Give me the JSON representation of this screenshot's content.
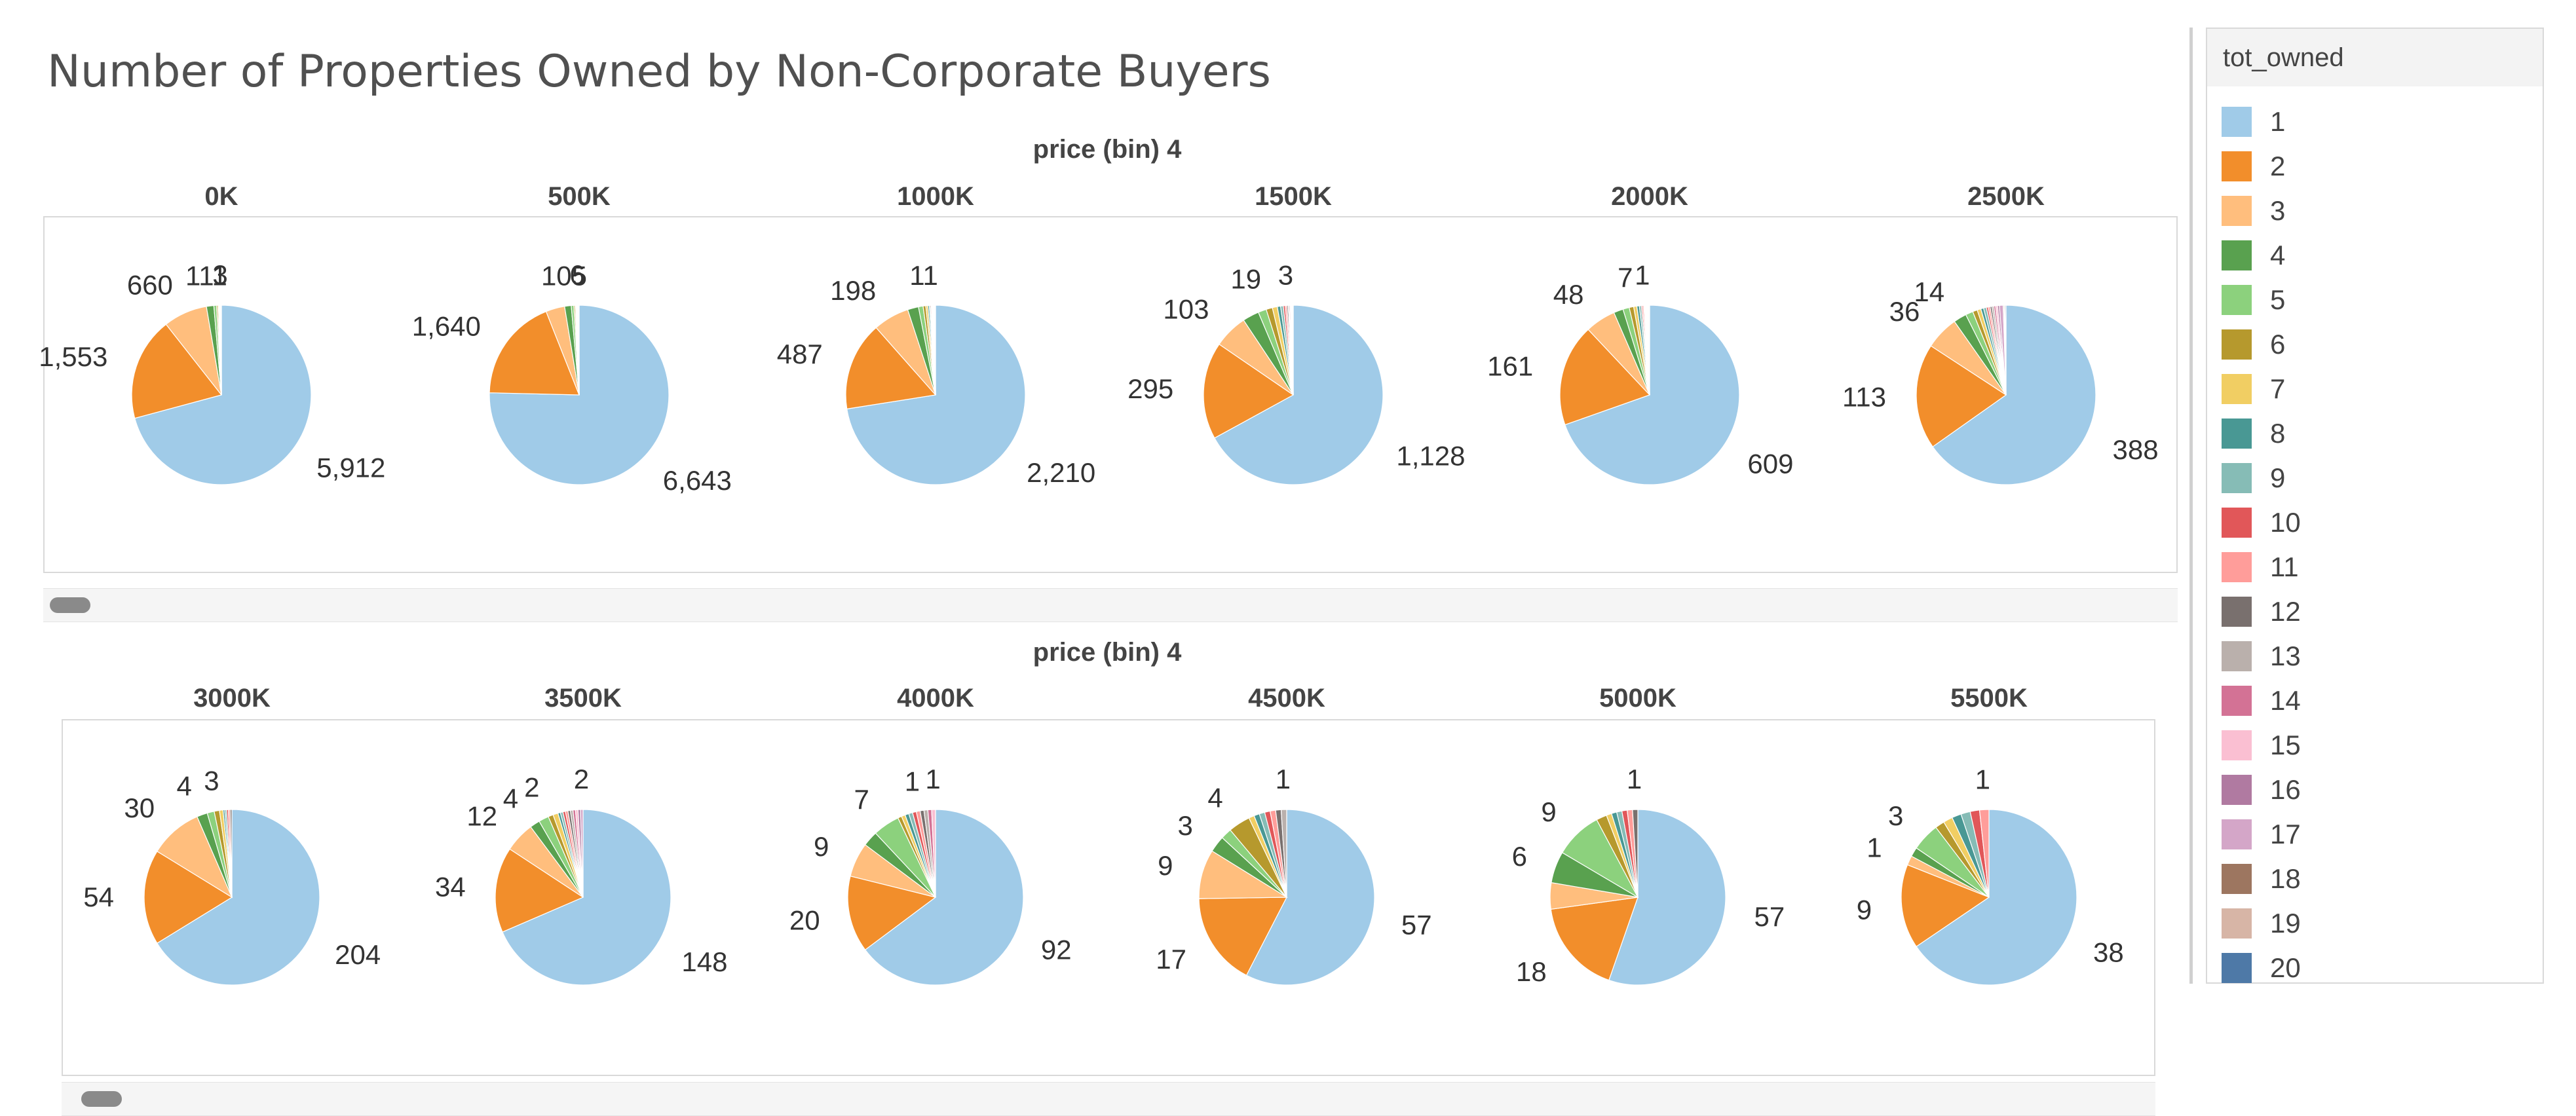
{
  "title": "Number of Properties Owned by Non-Corporate Buyers",
  "legend": {
    "title": "tot_owned",
    "items": [
      {
        "label": "1",
        "color": "#a0cbe8"
      },
      {
        "label": "2",
        "color": "#f28e2b"
      },
      {
        "label": "3",
        "color": "#ffbe7d"
      },
      {
        "label": "4",
        "color": "#59a14f"
      },
      {
        "label": "5",
        "color": "#8cd17d"
      },
      {
        "label": "6",
        "color": "#b6992d"
      },
      {
        "label": "7",
        "color": "#f1ce63"
      },
      {
        "label": "8",
        "color": "#499894"
      },
      {
        "label": "9",
        "color": "#86bcb6"
      },
      {
        "label": "10",
        "color": "#e15759"
      },
      {
        "label": "11",
        "color": "#ff9d9a"
      },
      {
        "label": "12",
        "color": "#79706e"
      },
      {
        "label": "13",
        "color": "#bab0ac"
      },
      {
        "label": "14",
        "color": "#d37295"
      },
      {
        "label": "15",
        "color": "#fabfd2"
      },
      {
        "label": "16",
        "color": "#b07aa1"
      },
      {
        "label": "17",
        "color": "#d4a6c8"
      },
      {
        "label": "18",
        "color": "#9d7660"
      },
      {
        "label": "19",
        "color": "#d7b5a6"
      },
      {
        "label": "20",
        "color": "#4e79a7"
      }
    ]
  },
  "chart_data": {
    "type": "pie",
    "facet_header": "price (bin) 4",
    "series_field": "tot_owned",
    "rows": [
      {
        "header": "price (bin) 4",
        "pies": [
          {
            "category": "0K",
            "values": [
              5912,
              1553,
              660,
              111,
              40,
              20,
              15,
              8,
              6,
              5,
              4,
              3,
              3,
              2,
              2,
              1,
              1,
              1,
              1,
              1
            ],
            "labels": [
              {
                "slice": 0,
                "text": "5,912"
              },
              {
                "slice": 1,
                "text": "1,553"
              },
              {
                "slice": 2,
                "text": "660"
              },
              {
                "slice": 3,
                "text": "111"
              },
              {
                "slice": 11,
                "text": "3"
              }
            ]
          },
          {
            "category": "500K",
            "values": [
              6643,
              1640,
              300,
              105,
              40,
              20,
              15,
              10,
              8,
              6,
              6,
              4,
              3,
              3,
              2,
              2,
              2,
              1,
              1,
              1
            ],
            "labels": [
              {
                "slice": 0,
                "text": "6,643"
              },
              {
                "slice": 1,
                "text": "1,640"
              },
              {
                "slice": 3,
                "text": "105"
              },
              {
                "slice": 10,
                "text": "6"
              }
            ]
          },
          {
            "category": "1000K",
            "values": [
              2210,
              487,
              198,
              60,
              25,
              15,
              11,
              8,
              6,
              5,
              4,
              4,
              3,
              3,
              2,
              2,
              2,
              1,
              1,
              1
            ],
            "labels": [
              {
                "slice": 0,
                "text": "2,210"
              },
              {
                "slice": 1,
                "text": "487"
              },
              {
                "slice": 2,
                "text": "198"
              },
              {
                "slice": 6,
                "text": "11"
              }
            ]
          },
          {
            "category": "1500K",
            "values": [
              1128,
              295,
              103,
              50,
              25,
              19,
              15,
              10,
              8,
              6,
              5,
              4,
              3,
              3,
              2,
              2,
              2,
              1,
              1,
              1
            ],
            "labels": [
              {
                "slice": 0,
                "text": "1,128"
              },
              {
                "slice": 1,
                "text": "295"
              },
              {
                "slice": 2,
                "text": "103"
              },
              {
                "slice": 5,
                "text": "19"
              },
              {
                "slice": 11,
                "text": "3"
              }
            ]
          },
          {
            "category": "2000K",
            "values": [
              609,
              161,
              48,
              15,
              10,
              7,
              5,
              4,
              3,
              2,
              2,
              1,
              1,
              1,
              1,
              1,
              1,
              1,
              1,
              1
            ],
            "labels": [
              {
                "slice": 0,
                "text": "609"
              },
              {
                "slice": 1,
                "text": "161"
              },
              {
                "slice": 2,
                "text": "48"
              },
              {
                "slice": 5,
                "text": "7"
              },
              {
                "slice": 11,
                "text": "1"
              }
            ]
          },
          {
            "category": "2500K",
            "values": [
              388,
              113,
              36,
              14,
              8,
              5,
              4,
              3,
              3,
              2,
              2,
              2,
              2,
              2,
              2,
              2,
              4,
              1,
              1,
              1
            ],
            "labels": [
              {
                "slice": 0,
                "text": "388"
              },
              {
                "slice": 1,
                "text": "113"
              },
              {
                "slice": 2,
                "text": "36"
              },
              {
                "slice": 3,
                "text": "14"
              }
            ]
          }
        ]
      },
      {
        "header": "price (bin) 4",
        "pies": [
          {
            "category": "3000K",
            "values": [
              204,
              54,
              30,
              6,
              4,
              3,
              2,
              1,
              1,
              1,
              1,
              1
            ],
            "labels": [
              {
                "slice": 0,
                "text": "204"
              },
              {
                "slice": 1,
                "text": "54"
              },
              {
                "slice": 2,
                "text": "30"
              },
              {
                "slice": 3,
                "text": "4"
              },
              {
                "slice": 5,
                "text": "3"
              }
            ]
          },
          {
            "category": "3500K",
            "values": [
              148,
              34,
              12,
              4,
              4,
              2,
              2,
              1,
              1,
              1,
              1,
              1,
              1,
              1,
              1,
              1,
              1
            ],
            "labels": [
              {
                "slice": 0,
                "text": "148"
              },
              {
                "slice": 1,
                "text": "34"
              },
              {
                "slice": 2,
                "text": "12"
              },
              {
                "slice": 3,
                "text": "4"
              },
              {
                "slice": 5,
                "text": "2"
              },
              {
                "slice": 16,
                "text": "2"
              }
            ]
          },
          {
            "category": "4000K",
            "values": [
              92,
              20,
              9,
              4,
              7,
              1,
              1,
              1,
              1,
              1,
              1,
              1,
              1,
              1,
              1
            ],
            "labels": [
              {
                "slice": 0,
                "text": "92"
              },
              {
                "slice": 1,
                "text": "20"
              },
              {
                "slice": 2,
                "text": "9"
              },
              {
                "slice": 4,
                "text": "7"
              },
              {
                "slice": 10,
                "text": "1"
              },
              {
                "slice": 14,
                "text": "1"
              }
            ]
          },
          {
            "category": "4500K",
            "values": [
              57,
              17,
              9,
              3,
              2,
              4,
              1,
              1,
              1,
              1,
              1,
              1,
              1
            ],
            "labels": [
              {
                "slice": 0,
                "text": "57"
              },
              {
                "slice": 1,
                "text": "17"
              },
              {
                "slice": 2,
                "text": "9"
              },
              {
                "slice": 3,
                "text": "3"
              },
              {
                "slice": 5,
                "text": "4"
              },
              {
                "slice": 12,
                "text": "1"
              }
            ]
          },
          {
            "category": "5000K",
            "values": [
              57,
              18,
              5,
              6,
              9,
              2,
              1,
              1,
              1,
              1,
              1,
              1
            ],
            "labels": [
              {
                "slice": 0,
                "text": "57"
              },
              {
                "slice": 1,
                "text": "18"
              },
              {
                "slice": 3,
                "text": "6"
              },
              {
                "slice": 4,
                "text": "9"
              },
              {
                "slice": 11,
                "text": "1"
              }
            ]
          },
          {
            "category": "5500K",
            "values": [
              38,
              9,
              1,
              1,
              3,
              1,
              1,
              1,
              1,
              1,
              1
            ],
            "labels": [
              {
                "slice": 0,
                "text": "38"
              },
              {
                "slice": 1,
                "text": "9"
              },
              {
                "slice": 2,
                "text": "1"
              },
              {
                "slice": 4,
                "text": "3"
              },
              {
                "slice": 10,
                "text": "1"
              }
            ]
          }
        ]
      }
    ]
  }
}
